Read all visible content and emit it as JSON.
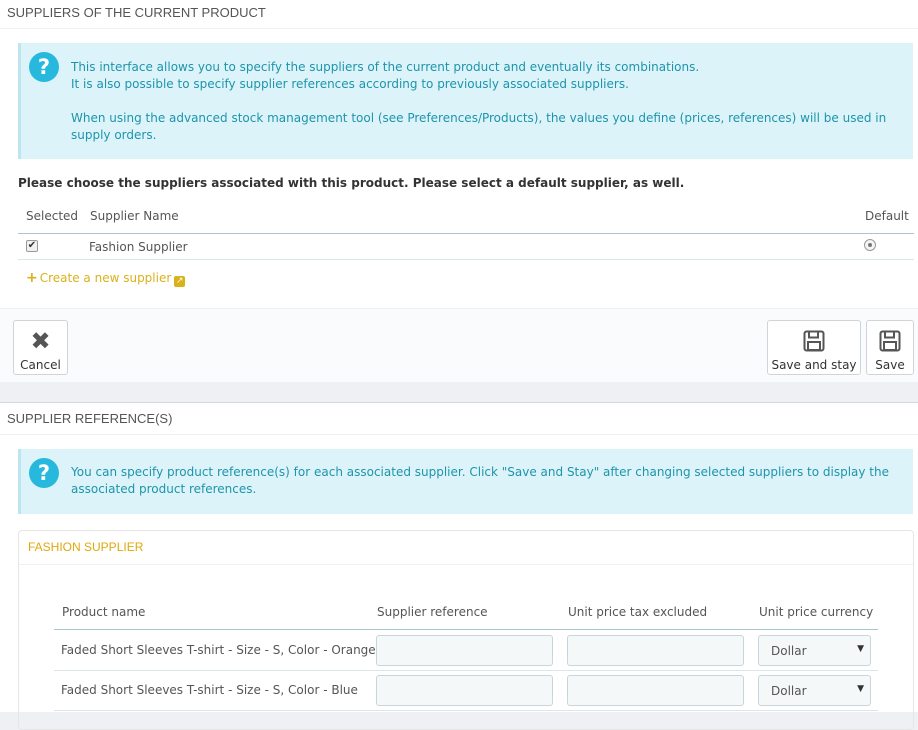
{
  "suppliers_panel": {
    "heading": "SUPPLIERS OF THE CURRENT PRODUCT",
    "info_line1": "This interface allows you to specify the suppliers of the current product and eventually its combinations.",
    "info_line2": "It is also possible to specify supplier references according to previously associated suppliers.",
    "info_line3": "When using the advanced stock management tool (see Preferences/Products), the values you define (prices, references) will be used in supply orders.",
    "instruction": "Please choose the suppliers associated with this product. Please select a default supplier, as well.",
    "columns": {
      "selected": "Selected",
      "name": "Supplier Name",
      "default": "Default"
    },
    "rows": [
      {
        "name": "Fashion Supplier",
        "selected": true,
        "default": true
      }
    ],
    "create_link": "Create a new supplier",
    "buttons": {
      "cancel": "Cancel",
      "save_stay": "Save and stay",
      "save": "Save"
    }
  },
  "refs_panel": {
    "heading": "SUPPLIER REFERENCE(S)",
    "info": "You can specify product reference(s) for each associated supplier. Click \"Save and Stay\" after changing selected suppliers to display the associated product references.",
    "supplier_heading": "FASHION SUPPLIER",
    "columns": {
      "product": "Product name",
      "reference": "Supplier reference",
      "price": "Unit price tax excluded",
      "currency": "Unit price currency"
    },
    "rows": [
      {
        "product": "Faded Short Sleeves T-shirt - Size - S, Color - Orange",
        "reference": "",
        "price": "",
        "currency": "Dollar"
      },
      {
        "product": "Faded Short Sleeves T-shirt - Size - S, Color - Blue",
        "reference": "",
        "price": "",
        "currency": "Dollar"
      }
    ]
  }
}
